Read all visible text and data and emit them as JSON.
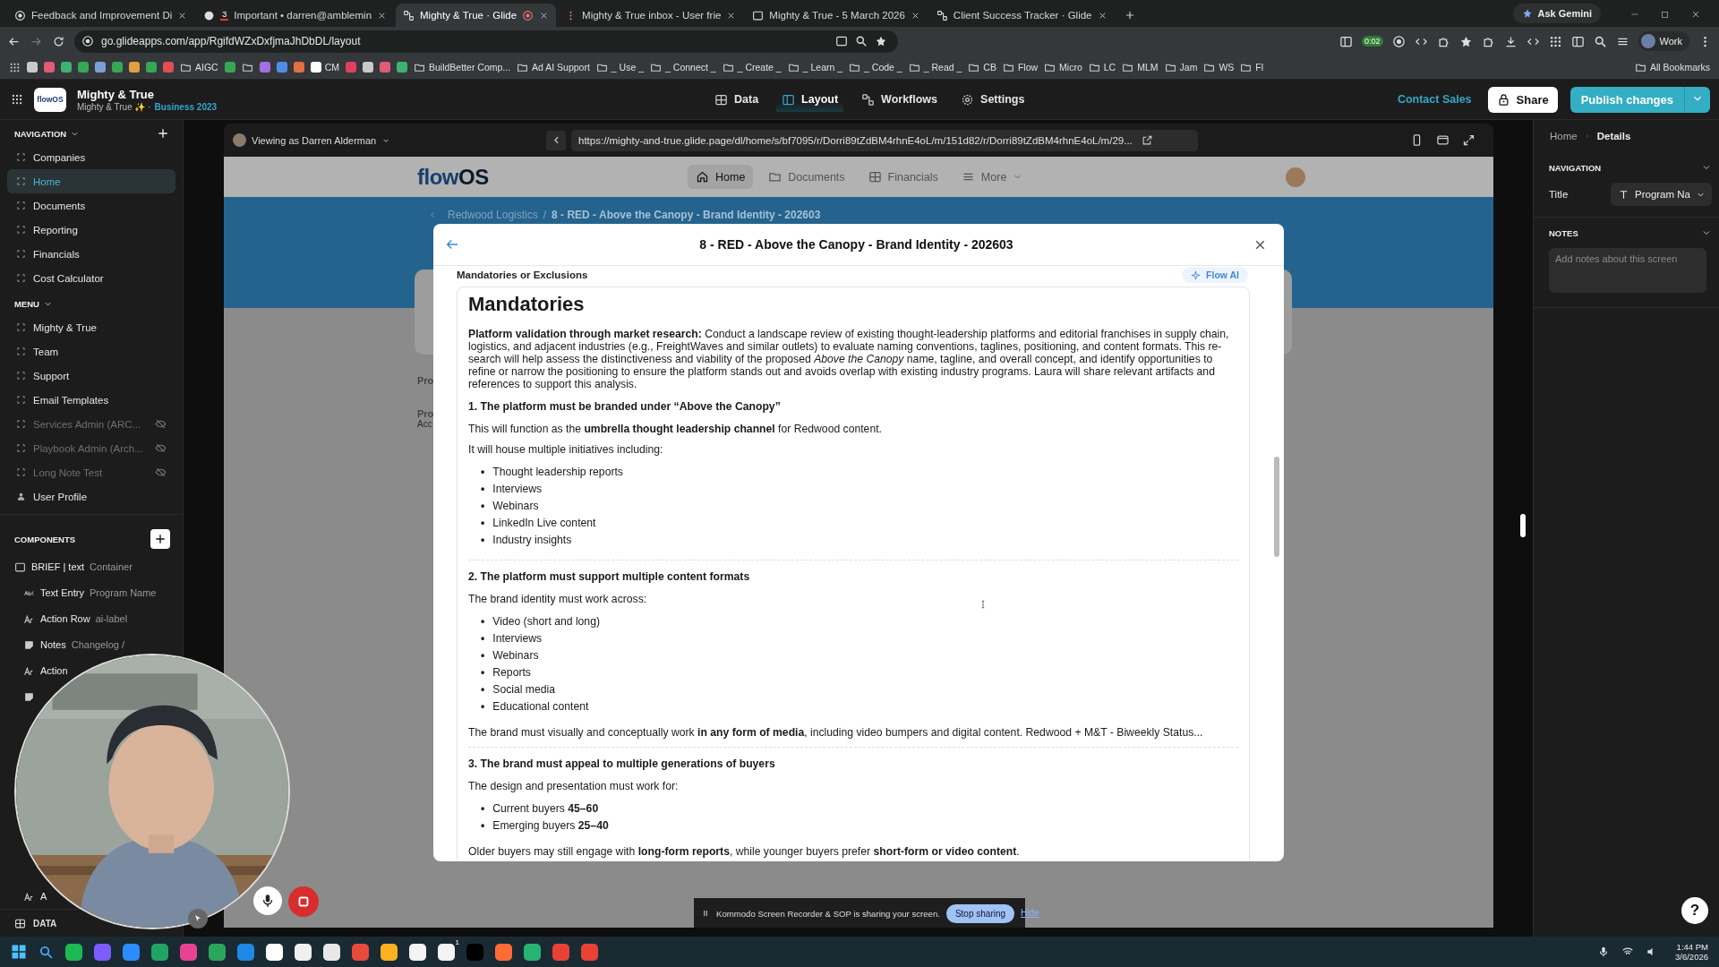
{
  "browser": {
    "tabs": [
      {
        "title": "Feedback and Improvement Di",
        "selected": false,
        "recording": false
      },
      {
        "title": "Important • darren@amblemin",
        "badge": "3",
        "selected": false,
        "recording": false
      },
      {
        "title": "Mighty & True · Glide",
        "selected": true,
        "recording": true
      },
      {
        "title": "Mighty & True inbox - User frie",
        "selected": false,
        "recording": false
      },
      {
        "title": "Mighty & True - 5 March 2026",
        "selected": false,
        "recording": false
      },
      {
        "title": "Client Success Tracker · Glide",
        "selected": false,
        "recording": false
      }
    ],
    "ask_gemini": "Ask Gemini",
    "address": "go.glideapps.com/app/RgifdWZxDxfjmaJhDbDL/layout",
    "timer": "0:02",
    "profile": "Work",
    "bookmarks": [
      {
        "kind": "site"
      },
      {
        "kind": "site"
      },
      {
        "kind": "site"
      },
      {
        "kind": "site"
      },
      {
        "kind": "site"
      },
      {
        "kind": "site"
      },
      {
        "kind": "site"
      },
      {
        "kind": "site"
      },
      {
        "kind": "site"
      },
      {
        "kind": "folder",
        "label": "AIGC"
      },
      {
        "kind": "site"
      },
      {
        "kind": "folder"
      },
      {
        "kind": "site"
      },
      {
        "kind": "site"
      },
      {
        "kind": "site"
      },
      {
        "kind": "site",
        "label": "CM"
      },
      {
        "kind": "site"
      },
      {
        "kind": "site"
      },
      {
        "kind": "site"
      },
      {
        "kind": "site"
      },
      {
        "kind": "folder",
        "label": "BuildBetter Comp..."
      },
      {
        "kind": "folder",
        "label": "Ad AI Support"
      },
      {
        "kind": "folder",
        "label": "_ Use _"
      },
      {
        "kind": "folder",
        "label": "_ Connect _"
      },
      {
        "kind": "folder",
        "label": "_ Create _"
      },
      {
        "kind": "folder",
        "label": "_ Learn _"
      },
      {
        "kind": "folder",
        "label": "_ Code _"
      },
      {
        "kind": "folder",
        "label": "_ Read _"
      },
      {
        "kind": "folder",
        "label": "CB"
      },
      {
        "kind": "folder",
        "label": "Flow"
      },
      {
        "kind": "folder",
        "label": "Micro"
      },
      {
        "kind": "folder",
        "label": "LC"
      },
      {
        "kind": "folder",
        "label": "MLM"
      },
      {
        "kind": "folder",
        "label": "Jam"
      },
      {
        "kind": "folder",
        "label": "WS"
      },
      {
        "kind": "folder",
        "label": "Fl"
      }
    ],
    "all_bookmarks": "All Bookmarks"
  },
  "app_header": {
    "logo_text": "flowOS",
    "app_name": "Mighty & True",
    "subtitle": "Mighty & True ✨ ·",
    "plan": "Business 2023",
    "tabs": [
      {
        "label": "Data",
        "selected": false
      },
      {
        "label": "Layout",
        "selected": true
      },
      {
        "label": "Workflows",
        "selected": false
      },
      {
        "label": "Settings",
        "selected": false
      }
    ],
    "contact_sales": "Contact Sales",
    "share": "Share",
    "publish": "Publish changes"
  },
  "sidebar": {
    "navigation_label": "NAVIGATION",
    "navigation": [
      {
        "label": "Companies",
        "selected": false
      },
      {
        "label": "Home",
        "selected": true
      },
      {
        "label": "Documents",
        "selected": false
      },
      {
        "label": "Reporting",
        "selected": false
      },
      {
        "label": "Financials",
        "selected": false
      },
      {
        "label": "Cost Calculator",
        "selected": false
      }
    ],
    "menu_label": "MENU",
    "menu": [
      {
        "kind": "screen",
        "label": "Mighty & True",
        "hidden": false
      },
      {
        "kind": "screen",
        "label": "Team",
        "hidden": false
      },
      {
        "kind": "screen",
        "label": "Support",
        "hidden": false
      },
      {
        "kind": "screen",
        "label": "Email Templates",
        "hidden": false
      },
      {
        "kind": "screen",
        "label": "Services Admin (ARC...",
        "hidden": true
      },
      {
        "kind": "screen",
        "label": "Playbook Admin (Arch...",
        "hidden": true
      },
      {
        "kind": "screen",
        "label": "Long Note Test",
        "hidden": true
      },
      {
        "kind": "profile",
        "label": "User Profile",
        "hidden": false
      }
    ],
    "components_label": "COMPONENTS",
    "components": [
      {
        "kind": "container",
        "label": "BRIEF | text",
        "detail": "Container",
        "children": [
          {
            "kind": "text-entry",
            "label": "Text Entry",
            "detail": "Program Name"
          },
          {
            "kind": "action-row",
            "label": "Action Row",
            "detail": "ai-label"
          },
          {
            "kind": "notes",
            "label": "Notes",
            "detail": "Changelog /"
          },
          {
            "kind": "action-row",
            "label": "Action"
          },
          {
            "kind": "notes"
          },
          {
            "kind": "action-row",
            "label": "A"
          }
        ]
      }
    ],
    "data": "DATA"
  },
  "canvas": {
    "viewing_as": "Viewing as Darren Alderman",
    "url": "https://mighty-and-true.glide.page/dl/home/s/bf7095/r/Dorri89tZdBM4rhnE4oL/m/151d82/r/Dorri89tZdBM4rhnE4oL/m/29...",
    "preview": {
      "logo": {
        "part_1": "flow",
        "part_2": "OS"
      },
      "nav": [
        {
          "label": "Home",
          "selected": true
        },
        {
          "label": "Documents",
          "selected": false
        },
        {
          "label": "Financials",
          "selected": false
        },
        {
          "label": "More",
          "selected": false
        }
      ],
      "breadcrumb": {
        "parent": "Redwood Logistics",
        "separator": "/",
        "current": "8 - RED - Above the Canopy - Brand Identity - 202603"
      },
      "background_texts": [
        "Pro",
        "Pro",
        "Acc"
      ],
      "modal": {
        "title": "8 - RED - Above the Canopy - Brand Identity - 202603",
        "section_label": "Mandatories or Exclusions",
        "ai_button": "Flow AI",
        "blocks": [
          {
            "kind": "heading",
            "text": "Mandatories"
          },
          {
            "kind": "paragraph",
            "text": "**Platform validation through market research:** Conduct a landscape review of existing thought-leadership platforms and editorial franchises in supply chain, logistics, and adjacent industries (e.g., FreightWaves and similar outlets) to evaluate naming conventions, taglines, positioning, and content formats. This re-search will help assess the distinctiveness and viability of the proposed *Above the Canopy* name, tagline, and overall concept, and identify opportunities to refine or narrow the positioning to ensure the platform stands out and avoids overlap with existing industry programs. Laura will share relevant artifacts and references to support this analysis."
          },
          {
            "kind": "subheading",
            "text": "1. The platform must be branded under “Above the Canopy”"
          },
          {
            "kind": "paragraph",
            "text": "This will function as the **umbrella thought leadership channel** for Redwood content."
          },
          {
            "kind": "paragraph",
            "text": "It will house multiple initiatives including:"
          },
          {
            "kind": "list",
            "marker": "•",
            "items": [
              "Thought leadership reports",
              "Interviews",
              "Webinars",
              "LinkedIn Live content",
              "Industry insights"
            ]
          },
          {
            "kind": "divider"
          },
          {
            "kind": "subheading",
            "text": "2. The platform must support multiple content formats"
          },
          {
            "kind": "paragraph",
            "text": "The brand identity must work across:"
          },
          {
            "kind": "list",
            "marker": "•",
            "items": [
              "Video (short and long)",
              "Interviews",
              "Webinars",
              "Reports",
              "Social media",
              "Educational content"
            ]
          },
          {
            "kind": "paragraph",
            "text": "The brand must visually and conceptually work **in any form of media**, including video bumpers and digital content. Redwood + M&T - Biweekly Status..."
          },
          {
            "kind": "divider"
          },
          {
            "kind": "subheading",
            "text": "3. The brand must appeal to multiple generations of buyers"
          },
          {
            "kind": "paragraph",
            "text": "The design and presentation must work for:"
          },
          {
            "kind": "list",
            "marker": "•",
            "items": [
              "Current buyers **45–60**",
              "Emerging buyers **25–40**"
            ]
          },
          {
            "kind": "paragraph",
            "text": "Older buyers may still engage with **long-form reports**, while younger buyers prefer **short-form or video content**."
          }
        ]
      }
    },
    "share_bar": {
      "message": "Kommodo Screen Recorder & SOP is sharing your screen.",
      "stop": "Stop sharing",
      "hide": "Hide"
    }
  },
  "right_panel": {
    "crumb_parent": "Home",
    "crumb_current": "Details",
    "navigation_label": "NAVIGATION",
    "title_label": "Title",
    "title_value": "Program Na",
    "notes_label": "NOTES",
    "notes_placeholder": "Add notes about this screen",
    "help": "?"
  },
  "taskbar": {
    "badge": "1",
    "time": "1:44 PM",
    "date": "3/6/2026"
  }
}
